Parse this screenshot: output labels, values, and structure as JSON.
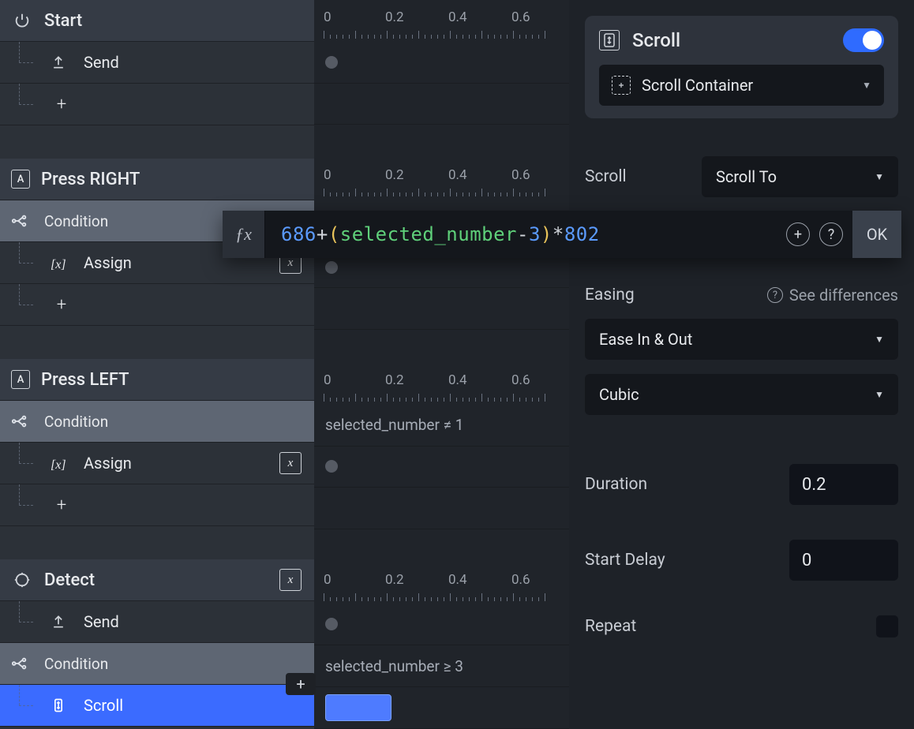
{
  "ruler": {
    "labels": [
      "0",
      "0.2",
      "0.4",
      "0.6"
    ]
  },
  "left": {
    "blocks": [
      {
        "header": {
          "icon": "power",
          "label": "Start"
        },
        "rows": [
          {
            "type": "child",
            "icon": "send",
            "label": "Send"
          },
          {
            "type": "add"
          }
        ],
        "timeline": [
          {
            "kind": "dot"
          }
        ]
      },
      {
        "header": {
          "icon": "key",
          "key": "A",
          "label": "Press RIGHT"
        },
        "rows": [
          {
            "type": "condition",
            "label": "Condition",
            "formula_active": true
          },
          {
            "type": "child",
            "icon": "assign",
            "label": "Assign",
            "right_icon": "x"
          },
          {
            "type": "add"
          }
        ],
        "timeline": [
          {
            "kind": "empty"
          },
          {
            "kind": "dot"
          }
        ]
      },
      {
        "header": {
          "icon": "key",
          "key": "A",
          "label": "Press LEFT"
        },
        "rows": [
          {
            "type": "condition",
            "label": "Condition"
          },
          {
            "type": "child",
            "icon": "assign",
            "label": "Assign",
            "right_icon": "x"
          },
          {
            "type": "add"
          }
        ],
        "timeline": [
          {
            "kind": "text",
            "text": "selected_number ≠ 1"
          },
          {
            "kind": "dot"
          }
        ]
      },
      {
        "header": {
          "icon": "target",
          "label": "Detect",
          "right_icon": "x"
        },
        "rows": [
          {
            "type": "child",
            "icon": "send",
            "label": "Send"
          },
          {
            "type": "condition",
            "label": "Condition",
            "plus_pill": true
          },
          {
            "type": "child",
            "icon": "scroll",
            "label": "Scroll",
            "selected": true
          }
        ],
        "timeline": [
          {
            "kind": "dot"
          },
          {
            "kind": "text",
            "text": "selected_number ≥ 3"
          },
          {
            "kind": "chip"
          }
        ]
      }
    ]
  },
  "formula": {
    "tokens": [
      {
        "t": "686",
        "c": "num"
      },
      {
        "t": "+",
        "c": "op"
      },
      {
        "t": "(",
        "c": "paren"
      },
      {
        "t": "selected_number",
        "c": "ident"
      },
      {
        "t": "-",
        "c": "op"
      },
      {
        "t": "3",
        "c": "num"
      },
      {
        "t": ")",
        "c": "paren"
      },
      {
        "t": "*",
        "c": "op"
      },
      {
        "t": "802",
        "c": "num"
      }
    ],
    "ok": "OK"
  },
  "right": {
    "panel": {
      "title": "Scroll",
      "target": "Scroll Container"
    },
    "scroll_label": "Scroll",
    "scroll_mode": "Scroll To",
    "easing_label": "Easing",
    "see_diff": "See differences",
    "easing_mode": "Ease In & Out",
    "easing_curve": "Cubic",
    "duration_label": "Duration",
    "duration_value": "0.2",
    "delay_label": "Start Delay",
    "delay_value": "0",
    "repeat_label": "Repeat"
  }
}
